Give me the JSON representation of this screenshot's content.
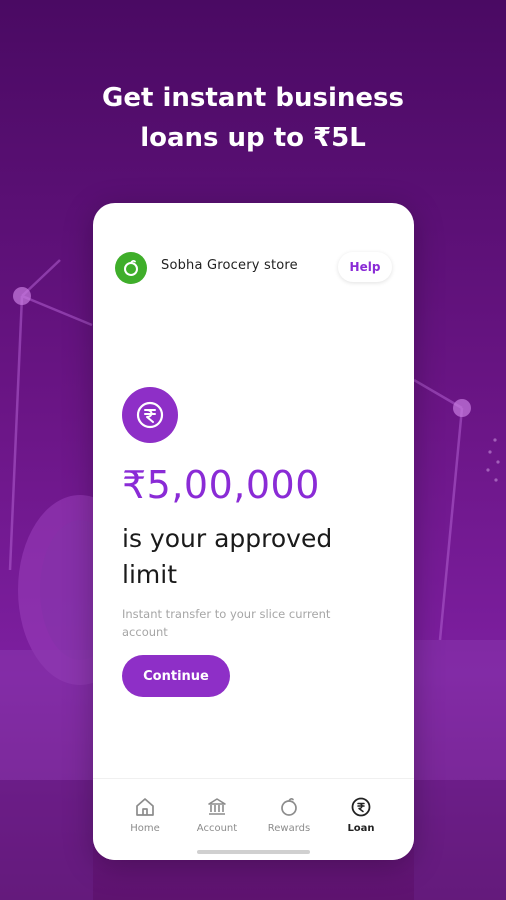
{
  "headline": {
    "line1": "Get instant business",
    "line2": "loans up to ₹5L"
  },
  "store": {
    "name": "Sobha Grocery store",
    "help_label": "Help"
  },
  "offer": {
    "amount": "₹5,00,000",
    "approved_text": "is your approved limit",
    "subtext": "Instant transfer to your slice current account",
    "continue_label": "Continue"
  },
  "nav": {
    "items": [
      {
        "label": "Home",
        "icon": "home-icon"
      },
      {
        "label": "Account",
        "icon": "bank-icon"
      },
      {
        "label": "Rewards",
        "icon": "rewards-icon"
      },
      {
        "label": "Loan",
        "icon": "rupee-icon"
      }
    ],
    "active": "Loan"
  },
  "colors": {
    "background": "#6a1585",
    "accent": "#8e2fc7",
    "store_icon": "#3fae2a"
  }
}
